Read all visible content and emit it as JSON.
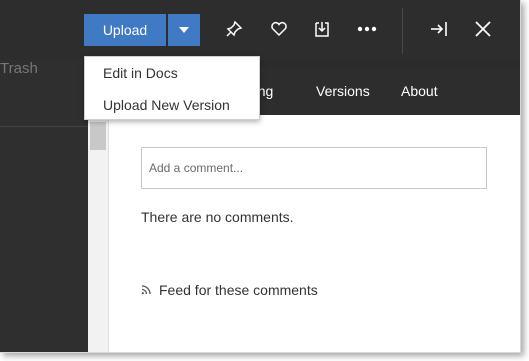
{
  "toolbar": {
    "upload_label": "Upload",
    "icons": [
      "pin-icon",
      "heart-icon",
      "download-icon",
      "more-icon",
      "collapse-right-icon",
      "close-icon"
    ],
    "accent_color": "#4079c4"
  },
  "dropdown": {
    "items": [
      {
        "label": "Edit in Docs"
      },
      {
        "label": "Upload New Version"
      }
    ]
  },
  "background": {
    "faded_heading": "Trash"
  },
  "tabs": [
    {
      "label": "ring"
    },
    {
      "label": "Versions"
    },
    {
      "label": "About"
    }
  ],
  "comments": {
    "placeholder": "Add a comment...",
    "empty_text": "There are no comments.",
    "feed_label": "Feed for these comments"
  }
}
